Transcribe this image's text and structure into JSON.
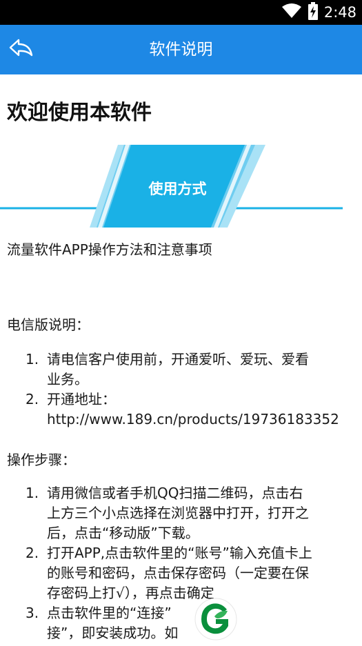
{
  "status_bar": {
    "time": "2:48",
    "wifi_icon": "wifi-icon",
    "battery_icon": "battery-charging-icon"
  },
  "app_bar": {
    "back_icon": "back-arrow-icon",
    "title": "软件说明"
  },
  "content": {
    "page_title": "欢迎使用本软件",
    "banner_label": "使用方式",
    "intro": "流量软件APP操作方法和注意事项",
    "telecom": {
      "title": "电信版说明：",
      "items": [
        {
          "num": "1.",
          "lines": [
            "请电信客户使用前，开通爱听、爱玩、爱看",
            "业务。"
          ]
        },
        {
          "num": "2.",
          "lines": [
            "开通地址：",
            "http://www.189.cn/products/19736183352"
          ]
        }
      ]
    },
    "steps": {
      "title": "操作步骤：",
      "items": [
        {
          "num": "1.",
          "lines": [
            "请用微信或者手机QQ扫描二维码，点击右",
            "上方三个小点选择在浏览器中打开，打开之",
            "后，点击“移动版”下载。"
          ]
        },
        {
          "num": "2.",
          "lines": [
            "打开APP,点击软件里的“账号”输入充值卡上",
            "的账号和密码，点击保存密码（一定要在保",
            "存密码上打√），再点击确定"
          ]
        },
        {
          "num": "3.",
          "lines": [
            "点击软件里的“连接”",
            "接”，即安装成功。如"
          ]
        }
      ]
    }
  },
  "colors": {
    "app_bar": "#1e88e5",
    "banner_dark": "#1ab1e6",
    "banner_light": "#8dd8f4",
    "fab_green": "#0a8f3c"
  },
  "fab": {
    "icon": "leaf-logo-icon"
  }
}
